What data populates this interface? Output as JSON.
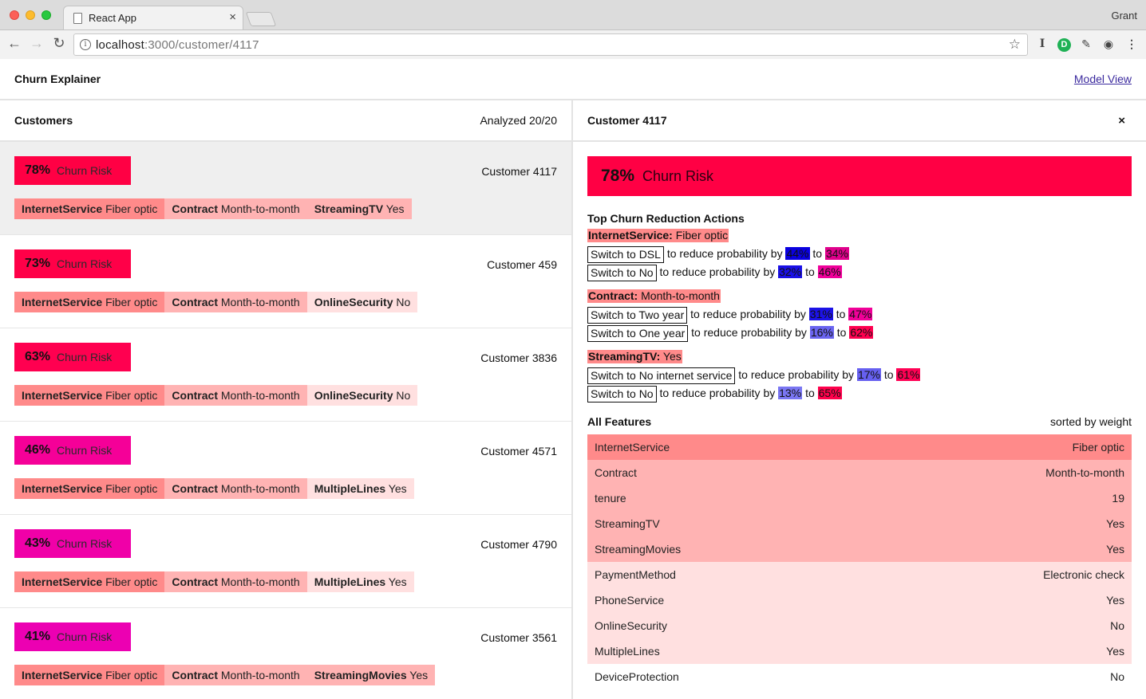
{
  "browser": {
    "tab_title": "React App",
    "tab_close": "×",
    "profile": "Grant",
    "url_host": "localhost",
    "url_path": ":3000/customer/4117",
    "info_glyph": "i",
    "star_glyph": "☆",
    "back_glyph": "←",
    "forward_glyph": "→",
    "reload_glyph": "↻",
    "ext_glyphs": [
      "I",
      "D",
      "✎",
      "◉",
      "⋮"
    ]
  },
  "header": {
    "title": "Churn Explainer",
    "model_link": "Model View"
  },
  "left_panel": {
    "title": "Customers",
    "analyzed": "Analyzed 20/20",
    "risk_label": "Churn Risk",
    "customers": [
      {
        "pct": "78%",
        "risk_color": "#ff0044",
        "name": "Customer 4117",
        "features": [
          {
            "k": "InternetService",
            "v": "Fiber optic",
            "color": "#ff8a8a"
          },
          {
            "k": "Contract",
            "v": "Month-to-month",
            "color": "#ffb3b3"
          },
          {
            "k": "StreamingTV",
            "v": "Yes",
            "color": "#ffb3b3"
          }
        ]
      },
      {
        "pct": "73%",
        "risk_color": "#ff0048",
        "name": "Customer 459",
        "features": [
          {
            "k": "InternetService",
            "v": "Fiber optic",
            "color": "#ff8a8a"
          },
          {
            "k": "Contract",
            "v": "Month-to-month",
            "color": "#ffb3b3"
          },
          {
            "k": "OnlineSecurity",
            "v": "No",
            "color": "#ffe0e0"
          }
        ]
      },
      {
        "pct": "63%",
        "risk_color": "#ff0050",
        "name": "Customer 3836",
        "features": [
          {
            "k": "InternetService",
            "v": "Fiber optic",
            "color": "#ff8a8a"
          },
          {
            "k": "Contract",
            "v": "Month-to-month",
            "color": "#ffb3b3"
          },
          {
            "k": "OnlineSecurity",
            "v": "No",
            "color": "#ffe0e0"
          }
        ]
      },
      {
        "pct": "46%",
        "risk_color": "#f50098",
        "name": "Customer 4571",
        "features": [
          {
            "k": "InternetService",
            "v": "Fiber optic",
            "color": "#ff8a8a"
          },
          {
            "k": "Contract",
            "v": "Month-to-month",
            "color": "#ffb3b3"
          },
          {
            "k": "MultipleLines",
            "v": "Yes",
            "color": "#ffe0e0"
          }
        ]
      },
      {
        "pct": "43%",
        "risk_color": "#f000a8",
        "name": "Customer 4790",
        "features": [
          {
            "k": "InternetService",
            "v": "Fiber optic",
            "color": "#ff8a8a"
          },
          {
            "k": "Contract",
            "v": "Month-to-month",
            "color": "#ffb3b3"
          },
          {
            "k": "MultipleLines",
            "v": "Yes",
            "color": "#ffe0e0"
          }
        ]
      },
      {
        "pct": "41%",
        "risk_color": "#ec00b2",
        "name": "Customer 3561",
        "features": [
          {
            "k": "InternetService",
            "v": "Fiber optic",
            "color": "#ff8a8a"
          },
          {
            "k": "Contract",
            "v": "Month-to-month",
            "color": "#ffb3b3"
          },
          {
            "k": "StreamingMovies",
            "v": "Yes",
            "color": "#ffb3b3"
          }
        ]
      }
    ]
  },
  "detail": {
    "title": "Customer 4117",
    "close": "×",
    "risk_pct": "78%",
    "risk_label": "Churn Risk",
    "actions_title": "Top Churn Reduction Actions",
    "action_text": "to reduce probability by",
    "to_text": "to",
    "groups": [
      {
        "k": "InternetService:",
        "v": "Fiber optic",
        "actions": [
          {
            "label": "Switch to DSL",
            "by": "44%",
            "by_color": "#0a00e0",
            "to": "34%",
            "to_color": "#e0008c"
          },
          {
            "label": "Switch to No",
            "by": "32%",
            "by_color": "#1a10e6",
            "to": "46%",
            "to_color": "#f0009a"
          }
        ]
      },
      {
        "k": "Contract:",
        "v": "Month-to-month",
        "actions": [
          {
            "label": "Switch to Two year",
            "by": "31%",
            "by_color": "#1c12e6",
            "to": "47%",
            "to_color": "#f00098"
          },
          {
            "label": "Switch to One year",
            "by": "16%",
            "by_color": "#6a64f0",
            "to": "62%",
            "to_color": "#ff0050"
          }
        ]
      },
      {
        "k": "StreamingTV:",
        "v": "Yes",
        "actions": [
          {
            "label": "Switch to No internet service",
            "by": "17%",
            "by_color": "#6660f0",
            "to": "61%",
            "to_color": "#ff0054"
          },
          {
            "label": "Switch to No",
            "by": "13%",
            "by_color": "#7a76f2",
            "to": "65%",
            "to_color": "#ff004c"
          }
        ]
      }
    ],
    "all_features_title": "All Features",
    "sorted_label": "sorted by weight",
    "features": [
      {
        "name": "InternetService",
        "value": "Fiber optic",
        "color": "#ff8a8a"
      },
      {
        "name": "Contract",
        "value": "Month-to-month",
        "color": "#ffb3b3"
      },
      {
        "name": "tenure",
        "value": "19",
        "color": "#ffb3b3"
      },
      {
        "name": "StreamingTV",
        "value": "Yes",
        "color": "#ffb3b3"
      },
      {
        "name": "StreamingMovies",
        "value": "Yes",
        "color": "#ffb3b3"
      },
      {
        "name": "PaymentMethod",
        "value": "Electronic check",
        "color": "#ffe0e0"
      },
      {
        "name": "PhoneService",
        "value": "Yes",
        "color": "#ffe0e0"
      },
      {
        "name": "OnlineSecurity",
        "value": "No",
        "color": "#ffe0e0"
      },
      {
        "name": "MultipleLines",
        "value": "Yes",
        "color": "#ffe0e0"
      },
      {
        "name": "DeviceProtection",
        "value": "No",
        "color": "#ffffff"
      }
    ]
  }
}
